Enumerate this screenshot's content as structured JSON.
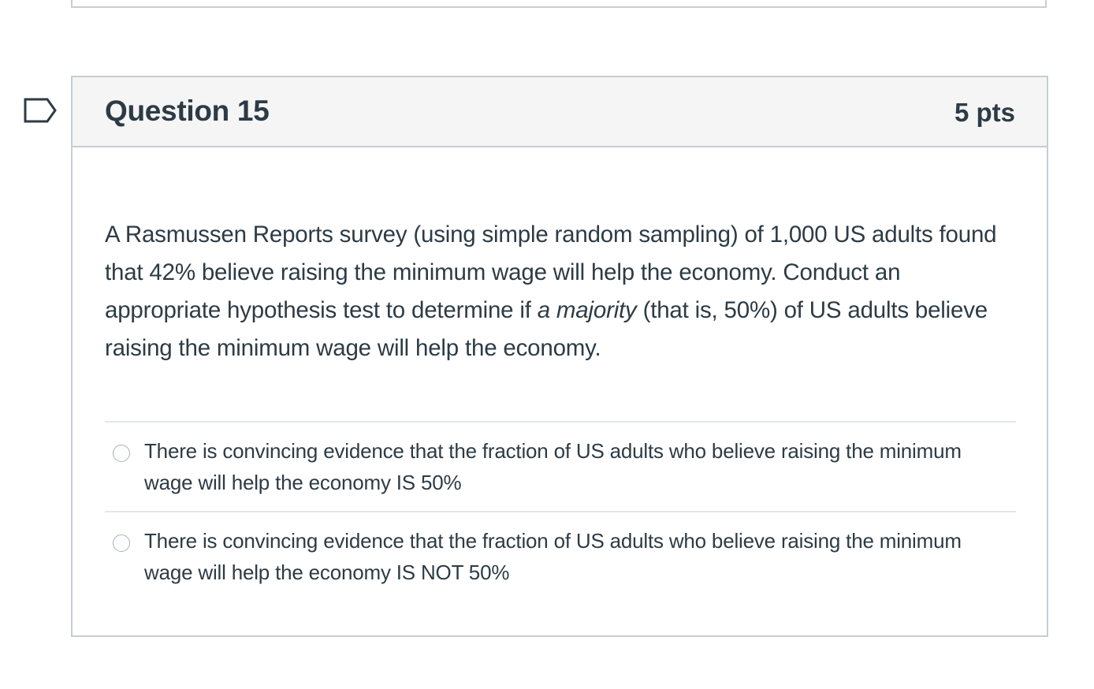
{
  "question": {
    "title": "Question 15",
    "points": "5 pts",
    "text_part1": "A Rasmussen Reports survey (using simple random sampling) of 1,000 US adults found that 42% believe raising the minimum wage will help the economy. Conduct an appropriate hypothesis test to determine if ",
    "text_emphasis": "a majority",
    "text_part2": " (that is, 50%) of US adults believe raising the minimum wage will help the economy."
  },
  "answers": [
    {
      "label": "There is convincing evidence that the fraction of US adults who believe raising the minimum wage will help the economy IS 50%"
    },
    {
      "label": "There is convincing evidence that the fraction of US adults who believe raising the minimum wage will help the economy IS NOT 50%"
    }
  ],
  "icons": {
    "flag": "flag-question-icon"
  },
  "colors": {
    "text": "#2d3b45",
    "border": "#c7cdd1",
    "header_bg": "#f5f5f5"
  }
}
